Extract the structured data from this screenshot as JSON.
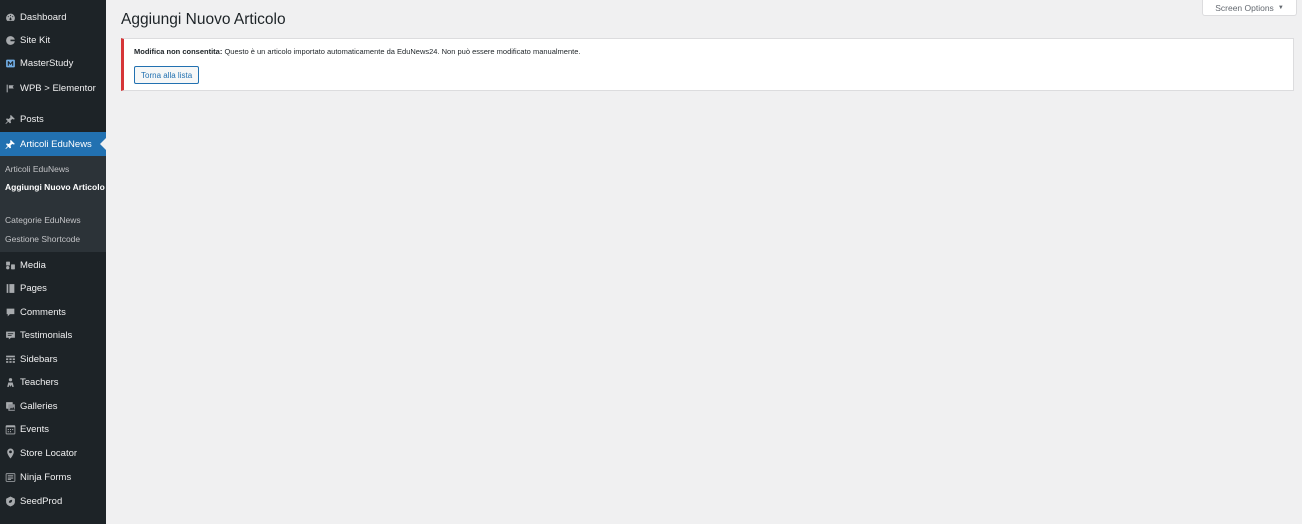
{
  "sidebar": {
    "items": [
      {
        "label": "Dashboard",
        "icon": "dashboard-icon"
      },
      {
        "label": "Site Kit",
        "icon": "site-kit-icon"
      },
      {
        "label": "MasterStudy",
        "icon": "masterstudy-icon"
      },
      {
        "label": "WPB > Elementor",
        "icon": "wpb-elementor-icon"
      },
      {
        "label": "Posts",
        "icon": "pushpin-icon"
      },
      {
        "label": "Articoli EduNews",
        "icon": "pushpin-icon"
      },
      {
        "label": "Media",
        "icon": "media-icon"
      },
      {
        "label": "Pages",
        "icon": "pages-icon"
      },
      {
        "label": "Comments",
        "icon": "comments-icon"
      },
      {
        "label": "Testimonials",
        "icon": "testimonials-icon"
      },
      {
        "label": "Sidebars",
        "icon": "sidebars-icon"
      },
      {
        "label": "Teachers",
        "icon": "teachers-icon"
      },
      {
        "label": "Galleries",
        "icon": "galleries-icon"
      },
      {
        "label": "Events",
        "icon": "calendar-icon"
      },
      {
        "label": "Store Locator",
        "icon": "location-pin-icon"
      },
      {
        "label": "Ninja Forms",
        "icon": "forms-icon"
      },
      {
        "label": "SeedProd",
        "icon": "seedprod-icon"
      }
    ],
    "submenu": [
      {
        "label": "Articoli EduNews"
      },
      {
        "label": "Aggiungi Nuovo Articolo"
      },
      {
        "label": "Categorie EduNews"
      },
      {
        "label": "Gestione Shortcode"
      }
    ]
  },
  "header": {
    "screen_options": "Screen Options",
    "screen_options_caret": "▼"
  },
  "main": {
    "title": "Aggiungi Nuovo Articolo",
    "notice": {
      "strong": "Modifica non consentita:",
      "message": "Questo è un articolo importato automaticamente da EduNews24. Non può essere modificato manualmente.",
      "button": "Torna alla lista"
    }
  },
  "colors": {
    "sidebar_bg": "#1d2327",
    "submenu_bg": "#2c3338",
    "accent": "#2271b1",
    "error": "#d63638",
    "page_bg": "#f0f0f1"
  }
}
